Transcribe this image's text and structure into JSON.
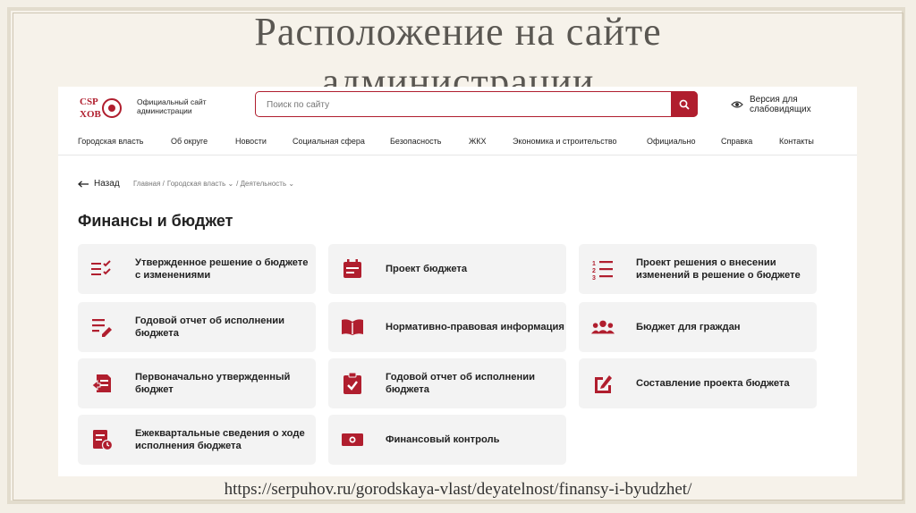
{
  "slide": {
    "title_line1": "Расположение на сайте",
    "title_line2": "администрации",
    "url": "https://serpuhov.ru/gorodskaya-vlast/deyatelnost/finansy-i-byudzhet/"
  },
  "header": {
    "site_name": "Официальный сайт администрации",
    "search_placeholder": "Поиск по сайту",
    "vision_label": "Версия для слабовидящих"
  },
  "nav": [
    "Городская власть",
    "Об округе",
    "Новости",
    "Социальная сфера",
    "Безопасность",
    "ЖКХ",
    "Экономика и строительство",
    "Официально",
    "Справка",
    "Контакты"
  ],
  "breadcrumbs": {
    "back_label": "Назад",
    "items": [
      "Главная /",
      "Городская власть ⌄",
      "/ Деятельность ⌄"
    ]
  },
  "page_title": "Финансы и бюджет",
  "cards": [
    {
      "label": "Утвержденное решение о бюджете с изменениями",
      "icon": "checklist-icon"
    },
    {
      "label": "Проект бюджета",
      "icon": "calendar-icon"
    },
    {
      "label": "Проект решения о внесении изменений в решение о бюджете",
      "icon": "numbered-list-icon"
    },
    {
      "label": "Годовой отчет об исполнении бюджета",
      "icon": "edit-list-icon"
    },
    {
      "label": "Нормативно-правовая информация",
      "icon": "book-icon"
    },
    {
      "label": "Бюджет для граждан",
      "icon": "people-icon"
    },
    {
      "label": "Первоначально утвержденный бюджет",
      "icon": "document-return-icon"
    },
    {
      "label": "Годовой отчет об исполнении бюджета",
      "icon": "clipboard-check-icon"
    },
    {
      "label": "Составление проекта бюджета",
      "icon": "edit-square-icon"
    },
    {
      "label": "Ежеквартальные сведения о ходе исполнения бюджета",
      "icon": "document-clock-icon"
    },
    {
      "label": "Финансовый контроль",
      "icon": "money-icon"
    }
  ],
  "colors": {
    "accent": "#b01e2e"
  }
}
